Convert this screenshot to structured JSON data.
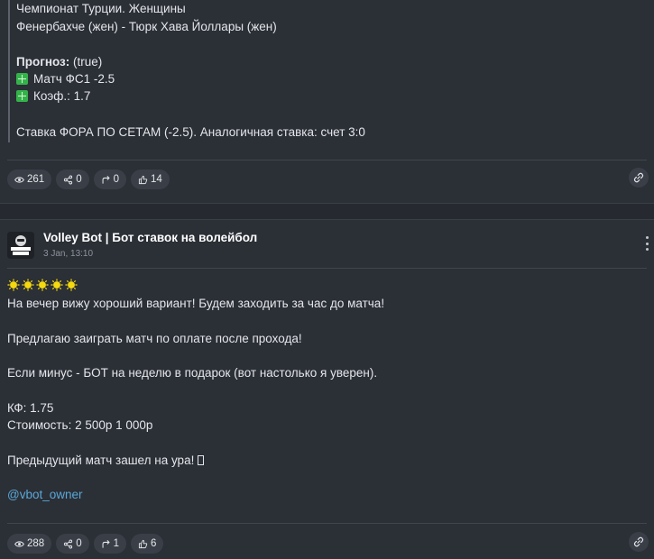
{
  "post1": {
    "lines": {
      "league": "Чемпионат Турции. Женщины",
      "match": "Фенербахче (жен) - Тюрк Хава Йоллары (жен)",
      "forecast_label": "Прогноз:",
      "forecast_value": "(true)",
      "bet_line": "Матч ФС1 -2.5",
      "coef_line": "Коэф.: 1.7",
      "note": "Ставка ФОРА ПО СЕТАМ (-2.5). Аналогичная ставка: счет 3:0"
    },
    "stats": {
      "views": "261",
      "shares": "0",
      "forwards": "0",
      "likes": "14"
    }
  },
  "post2": {
    "channel_name": "Volley Bot | Бот ставок на волейбол",
    "date": "3 Jan, 13:10",
    "lines": {
      "l1": "На вечер вижу хороший вариант! Будем заходить за час до матча!",
      "l2": "Предлагаю заиграть матч по оплате после прохода!",
      "l3": "Если минус - БОТ на неделю в подарок (вот настолько я уверен).",
      "l4": "КФ: 1.75",
      "l5": "Стоимость: 2 500р 1 000р",
      "l6": "Предыдущий матч зашел на ура! ",
      "mention": "@vbot_owner"
    },
    "stats": {
      "views": "288",
      "shares": "0",
      "forwards": "1",
      "likes": "6"
    }
  },
  "icons": {
    "views": "eye-icon",
    "shares": "share-icon",
    "forwards": "forward-icon",
    "likes": "thumbs-up-icon",
    "link": "link-icon",
    "menu": "more-vertical-icon",
    "stars": "sun-emoji-icon",
    "green": "green-sparkle-emoji-icon"
  },
  "colors": {
    "background": "#2b2f36",
    "pill": "#3a3f47",
    "mention": "#5aa8d8"
  }
}
